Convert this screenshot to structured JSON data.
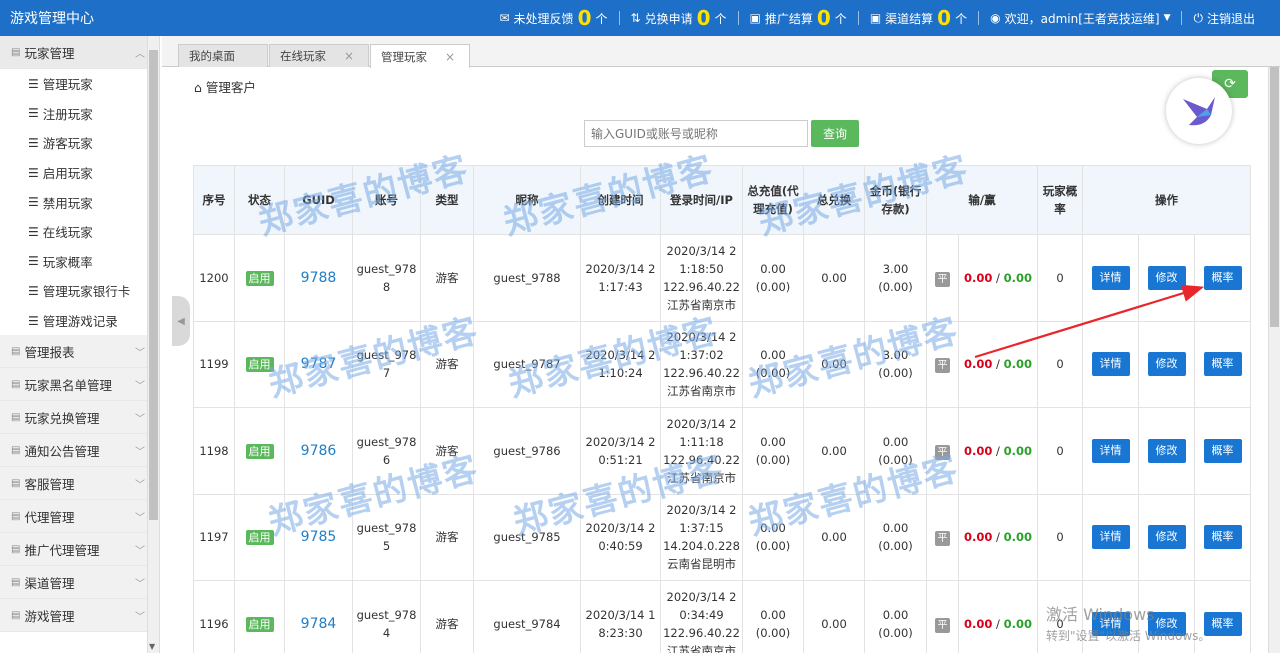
{
  "app": {
    "title": "游戏管理中心"
  },
  "topbar": {
    "items": [
      {
        "icon": "envelope-icon",
        "label": "未处理反馈",
        "count": "0",
        "unit": "个"
      },
      {
        "icon": "exchange-icon",
        "label": "兑换申请",
        "count": "0",
        "unit": "个"
      },
      {
        "icon": "promo-icon",
        "label": "推广结算",
        "count": "0",
        "unit": "个"
      },
      {
        "icon": "channel-icon",
        "label": "渠道结算",
        "count": "0",
        "unit": "个"
      }
    ],
    "welcome": "欢迎，admin[王者竞技运维]",
    "logout": "注销退出"
  },
  "sidebar": {
    "open_group": "玩家管理",
    "sub_items": [
      "管理玩家",
      "注册玩家",
      "游客玩家",
      "启用玩家",
      "禁用玩家",
      "在线玩家",
      "玩家概率",
      "管理玩家银行卡",
      "管理游戏记录"
    ],
    "groups": [
      "管理报表",
      "玩家黑名单管理",
      "玩家兑换管理",
      "通知公告管理",
      "客服管理",
      "代理管理",
      "推广代理管理",
      "渠道管理",
      "游戏管理"
    ]
  },
  "tabs": [
    {
      "label": "我的桌面",
      "closable": false
    },
    {
      "label": "在线玩家",
      "closable": true
    },
    {
      "label": "管理玩家",
      "closable": true,
      "active": true
    }
  ],
  "breadcrumb": "管理客户",
  "search": {
    "placeholder": "输入GUID或账号或昵称",
    "button": "查询"
  },
  "table": {
    "headers": [
      "序号",
      "状态",
      "GUID",
      "账号",
      "类型",
      "昵称",
      "创建时间",
      "登录时间/IP",
      "总充值(代理充值)",
      "总兑换",
      "金币(银行存款)",
      "输/赢",
      "",
      "玩家概率",
      "操作"
    ],
    "rows": [
      {
        "seq": "1200",
        "status": "启用",
        "guid": "9788",
        "account": "guest_9788",
        "type": "游客",
        "nick": "guest_9788",
        "created": "2020/3/14 21:17:43",
        "login": "2020/3/14 21:18:50",
        "ip": "122.96.40.22",
        "location": "江苏省南京市",
        "recharge": "0.00",
        "recharge_agent": "(0.00)",
        "exchange": "0.00",
        "gold": "3.00",
        "bank": "(0.00)",
        "flag": "平",
        "loss": "0.00",
        "win": "0.00",
        "prob": "0"
      },
      {
        "seq": "1199",
        "status": "启用",
        "guid": "9787",
        "account": "guest_9787",
        "type": "游客",
        "nick": "guest_9787",
        "created": "2020/3/14 21:10:24",
        "login": "2020/3/14 21:37:02",
        "ip": "122.96.40.22",
        "location": "江苏省南京市",
        "recharge": "0.00",
        "recharge_agent": "(0.00)",
        "exchange": "0.00",
        "gold": "3.00",
        "bank": "(0.00)",
        "flag": "平",
        "loss": "0.00",
        "win": "0.00",
        "prob": "0"
      },
      {
        "seq": "1198",
        "status": "启用",
        "guid": "9786",
        "account": "guest_9786",
        "type": "游客",
        "nick": "guest_9786",
        "created": "2020/3/14 20:51:21",
        "login": "2020/3/14 21:11:18",
        "ip": "122.96.40.22",
        "location": "江苏省南京市",
        "recharge": "0.00",
        "recharge_agent": "(0.00)",
        "exchange": "0.00",
        "gold": "0.00",
        "bank": "(0.00)",
        "flag": "平",
        "loss": "0.00",
        "win": "0.00",
        "prob": "0"
      },
      {
        "seq": "1197",
        "status": "启用",
        "guid": "9785",
        "account": "guest_9785",
        "type": "游客",
        "nick": "guest_9785",
        "created": "2020/3/14 20:40:59",
        "login": "2020/3/14 21:37:15",
        "ip": "14.204.0.228",
        "location": "云南省昆明市",
        "recharge": "0.00",
        "recharge_agent": "(0.00)",
        "exchange": "0.00",
        "gold": "0.00",
        "bank": "(0.00)",
        "flag": "平",
        "loss": "0.00",
        "win": "0.00",
        "prob": "0"
      },
      {
        "seq": "1196",
        "status": "启用",
        "guid": "9784",
        "account": "guest_9784",
        "type": "游客",
        "nick": "guest_9784",
        "created": "2020/3/14 18:23:30",
        "login": "2020/3/14 20:34:49",
        "ip": "122.96.40.22",
        "location": "江苏省南京市",
        "recharge": "0.00",
        "recharge_agent": "(0.00)",
        "exchange": "0.00",
        "gold": "0.00",
        "bank": "(0.00)",
        "flag": "平",
        "loss": "0.00",
        "win": "0.00",
        "prob": "0"
      }
    ],
    "actions": {
      "detail": "详情",
      "edit": "修改",
      "prob": "概率"
    }
  },
  "watermark": "郑家喜的博客",
  "windows_activation": {
    "line1": "激活 Windows",
    "line2": "转到\"设置\"以激活 Windows。"
  },
  "colors": {
    "topbar": "#1e6fc7",
    "count": "#ffe100",
    "status_green": "#5cb85c",
    "action_blue": "#1976d2",
    "loss_red": "#d9001b",
    "win_green": "#2aa12a"
  }
}
